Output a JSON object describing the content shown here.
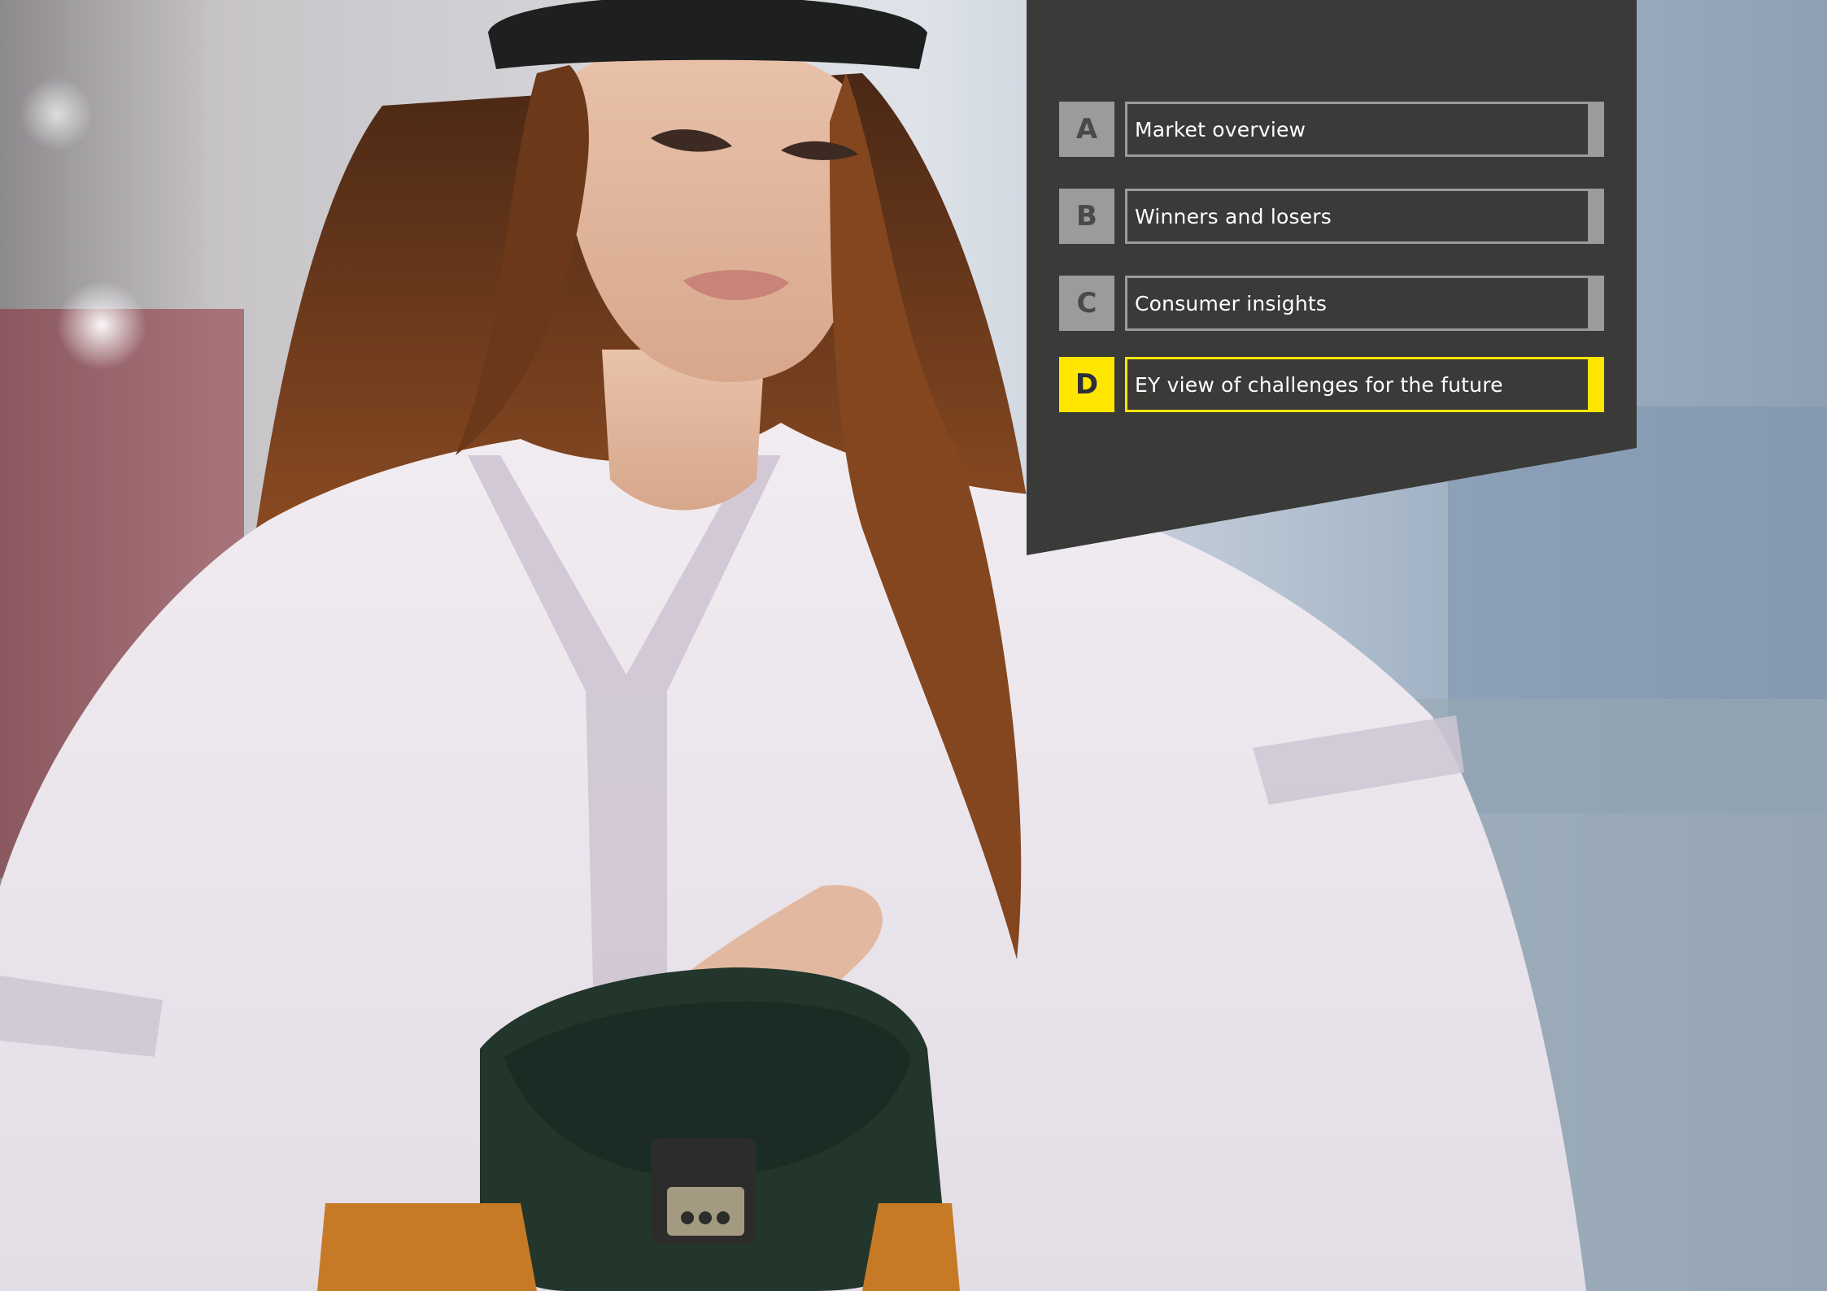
{
  "colors": {
    "panel": "#3a3a38",
    "inactive": "#9b9b99",
    "active": "#ffe600",
    "text": "#ffffff"
  },
  "nav": {
    "items": [
      {
        "letter": "A",
        "label": "Market overview",
        "active": false
      },
      {
        "letter": "B",
        "label": "Winners and losers",
        "active": false
      },
      {
        "letter": "C",
        "label": "Consumer insights",
        "active": false
      },
      {
        "letter": "D",
        "label": "EY view of challenges for the future",
        "active": true
      }
    ]
  }
}
